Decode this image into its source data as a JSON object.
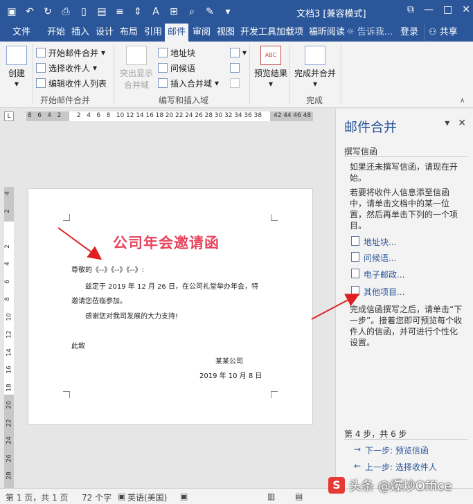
{
  "window": {
    "title": "文档3 [兼容模式] - Word",
    "title_short": "文档3  [兼容模式]",
    "controls": [
      "restore-icon",
      "minimize-icon",
      "maximize-icon",
      "close-icon"
    ]
  },
  "tabs": [
    {
      "label": "文件"
    },
    {
      "label": "开始"
    },
    {
      "label": "插入"
    },
    {
      "label": "设计"
    },
    {
      "label": "布局"
    },
    {
      "label": "引用"
    },
    {
      "label": "邮件",
      "active": true
    },
    {
      "label": "审阅"
    },
    {
      "label": "视图"
    },
    {
      "label": "开发工具"
    },
    {
      "label": "加载项"
    },
    {
      "label": "福昕阅读"
    }
  ],
  "tell_me": "告诉我...",
  "login": "登录",
  "share": "共享",
  "ribbon": {
    "create": "创建",
    "start_merge": "开始邮件合并",
    "select_recipients": "选择收件人",
    "edit_list": "编辑收件人列表",
    "group1": "开始邮件合并",
    "highlight1": "突出显示",
    "highlight2": "合并域",
    "address_block": "地址块",
    "greeting": "问候语",
    "insert_field": "插入合并域",
    "group2": "编写和插入域",
    "preview": "预览结果",
    "finish": "完成并合并",
    "group3": "完成"
  },
  "ruler": {
    "h_ticks": [
      "8",
      "6",
      "4",
      "2",
      "",
      "2",
      "4",
      "6",
      "8",
      "10",
      "12",
      "14",
      "16",
      "18",
      "20",
      "22",
      "24",
      "26",
      "28",
      "30",
      "32",
      "34",
      "36",
      "38",
      "",
      "42",
      "44",
      "46",
      "48"
    ],
    "v_ticks": [
      "4",
      "2",
      "",
      "2",
      "4",
      "6",
      "8",
      "10",
      "12",
      "14",
      "16",
      "18",
      "20",
      "22",
      "24",
      "26",
      "28"
    ]
  },
  "document": {
    "heading": "公司年会邀请函",
    "salutation": "尊敬的《--》《--》《--》:",
    "para1_line1": "兹定于 2019 年 12 月 26 日，在公司礼堂举办年会，特",
    "para1_line2": "邀请您莅临参加。",
    "para2": "感谢您对我司发展的大力支持!",
    "closing": "此致",
    "company": "某某公司",
    "date": "2019 年 10 月 8 日"
  },
  "pane": {
    "title": "邮件合并",
    "section": "撰写信函",
    "p1": "如果还未撰写信函，请现在开始。",
    "p2": "若要将收件人信息添至信函中，请单击文档中的某一位置，然后再单击下列的一个项目。",
    "links": [
      {
        "label": "地址块..."
      },
      {
        "label": "问候语..."
      },
      {
        "label": "电子邮政..."
      },
      {
        "label": "其他项目..."
      }
    ],
    "p3": "完成信函撰写之后，请单击“下一步”。接着您即可预览每个收件人的信函，并可进行个性化设置。",
    "step": "第 4 步，共 6 步",
    "next": "下一步: 预览信函",
    "prev": "上一步: 选择收件人"
  },
  "status": {
    "page": "第 1 页，共 1 页",
    "words": "72 个字",
    "lang": "英语(美国)"
  },
  "watermark": "头条 @爆炒Office",
  "colors": {
    "accent": "#2b579a",
    "heading_red": "#e8455e",
    "arrow_red": "#e02020"
  }
}
